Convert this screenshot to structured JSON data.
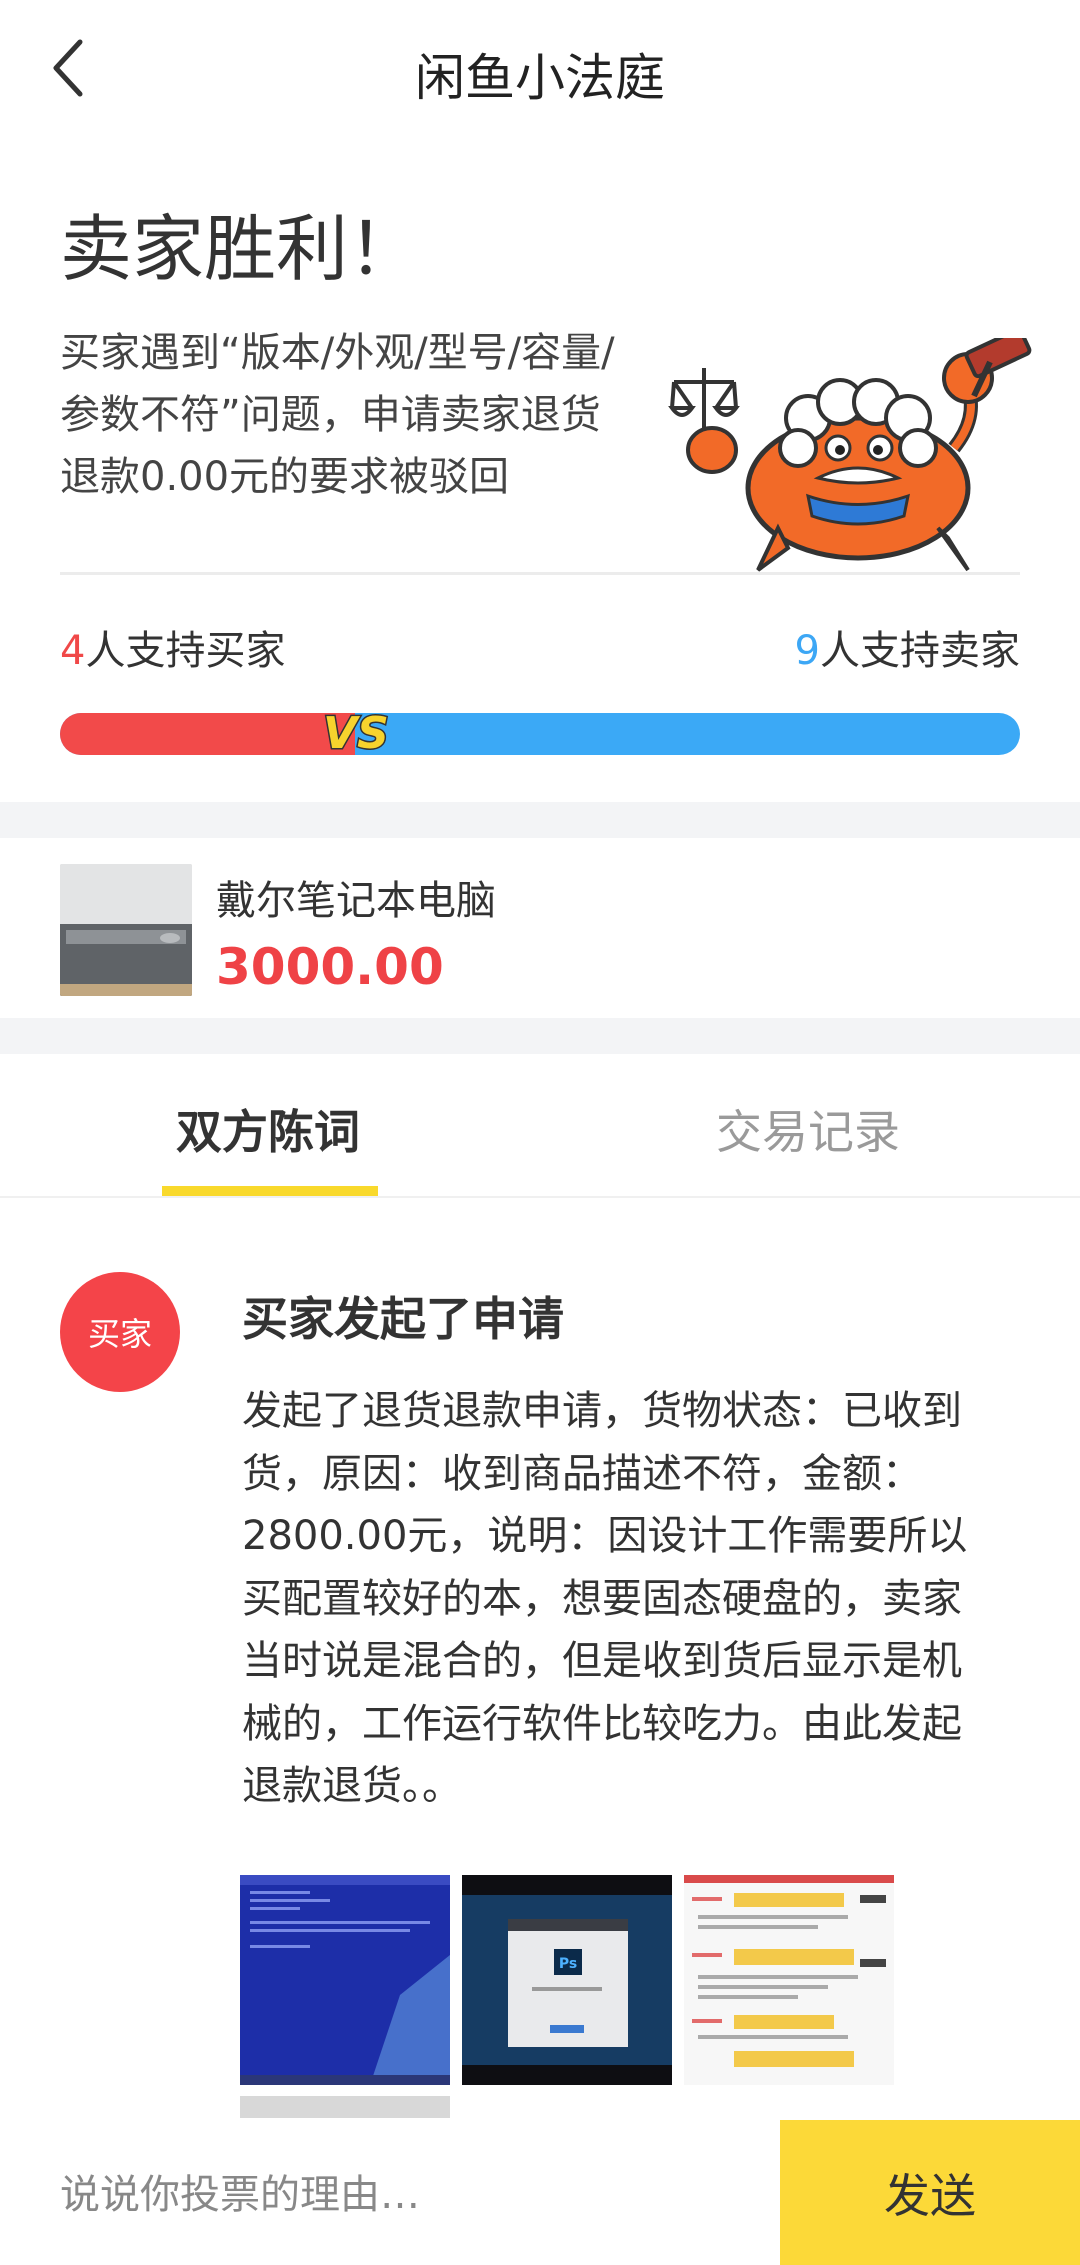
{
  "nav": {
    "title": "闲鱼小法庭"
  },
  "verdict": {
    "title": "卖家胜利！",
    "desc_lines": [
      "买家遇到“版本/外观/型号/容量/",
      "参数不符”问题，申请卖家退货",
      "退款0.00元的要求被驳回"
    ]
  },
  "support": {
    "buyer_count": "4",
    "buyer_label": "人支持买家",
    "seller_count": "9",
    "seller_label": "人支持卖家",
    "buyer_fraction": 0.3077,
    "vs_label": "VS"
  },
  "product": {
    "name": "戴尔笔记本电脑",
    "price": "3000.00"
  },
  "tabs": [
    {
      "label": "双方陈词",
      "active": true
    },
    {
      "label": "交易记录",
      "active": false
    }
  ],
  "statement": {
    "avatar_label": "买家",
    "title": "买家发起了申请",
    "body_lines": [
      "发起了退货退款申请，货物状态：已收到",
      "货，原因：收到商品描述不符，金额：",
      "2800.00元，说明：因设计工作需要所以",
      "买配置较好的本，想要固态硬盘的，卖家",
      "当时说是混合的，但是收到货后显示是机",
      "械的，工作运行软件比较吃力。由此发起",
      "退款退货。。"
    ]
  },
  "bottom": {
    "placeholder": "说说你投票的理由…",
    "send_label": "发送"
  },
  "colors": {
    "buyer": "#f04848",
    "seller": "#3da7f5",
    "accent": "#fcd938"
  }
}
